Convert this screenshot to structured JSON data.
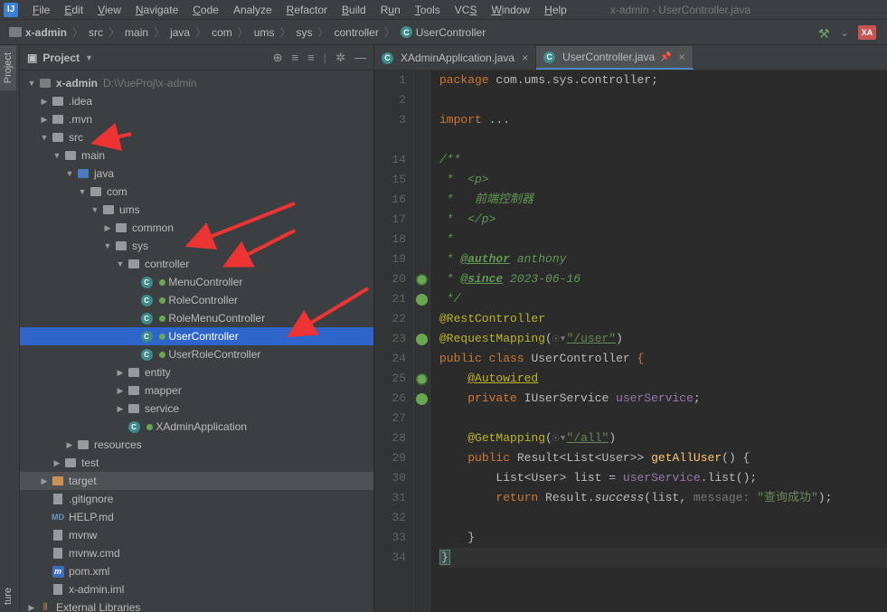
{
  "window_title": "x-admin - UserController.java",
  "menu": {
    "file": "File",
    "edit": "Edit",
    "view": "View",
    "navigate": "Navigate",
    "code": "Code",
    "analyze": "Analyze",
    "refactor": "Refactor",
    "build": "Build",
    "run": "Run",
    "tools": "Tools",
    "vcs": "VCS",
    "window": "Window",
    "help": "Help"
  },
  "breadcrumbs": {
    "root": "x-admin",
    "0": "src",
    "1": "main",
    "2": "java",
    "3": "com",
    "4": "ums",
    "5": "sys",
    "6": "controller",
    "7": "UserController"
  },
  "nav_right_badge": "XA",
  "left_tabs": {
    "project": "Project",
    "structure": "ture"
  },
  "project_panel": {
    "title": "Project",
    "root": "x-admin",
    "root_path": "D:\\VueProj\\x-admin",
    "idea": ".idea",
    "mvn": ".mvn",
    "src": "src",
    "main": "main",
    "java": "java",
    "com": "com",
    "ums": "ums",
    "common": "common",
    "sys": "sys",
    "controller": "controller",
    "menu_ctrl": "MenuController",
    "role_ctrl": "RoleController",
    "rolemenu_ctrl": "RoleMenuController",
    "user_ctrl": "UserController",
    "userrole_ctrl": "UserRoleController",
    "entity": "entity",
    "mapper": "mapper",
    "service": "service",
    "xadmin_app": "XAdminApplication",
    "resources": "resources",
    "test": "test",
    "target": "target",
    "gitignore": ".gitignore",
    "helpmd": "HELP.md",
    "mvnw": "mvnw",
    "mvnwcmd": "mvnw.cmd",
    "pomxml": "pom.xml",
    "iml": "x-admin.iml",
    "ext_lib": "External Libraries"
  },
  "tabs": {
    "t1": "XAdminApplication.java",
    "t2": "UserController.java"
  },
  "code": {
    "gutter": [
      "1",
      "2",
      "3",
      "",
      "14",
      "15",
      "16",
      "17",
      "18",
      "19",
      "20",
      "21",
      "22",
      "23",
      "24",
      "25",
      "26",
      "27",
      "28",
      "29",
      "30",
      "31",
      "32",
      "33",
      "34",
      ""
    ],
    "l1_pkg": "package",
    "l1_txt": "com.ums.sys.controller",
    "l3_imp": "import",
    "l3_txt": "...",
    "c14": "/**",
    "c15": " *  <p>",
    "c16": " *   前端控制器",
    "c17": " *  </p>",
    "c18": " *",
    "c19a": " * ",
    "c19b": "@author",
    "c19c": " anthony",
    "c20a": " * ",
    "c20b": "@since",
    "c20c": " 2023-06-16",
    "c21": " */",
    "a_rest": "@RestController",
    "a_reqmap": "@RequestMapping",
    "a_reqmap_val": "\"/user\"",
    "kw_public": "public",
    "kw_class": "class",
    "cls_user": "UserController",
    "a_autowired": "@Autowired",
    "kw_private": "private",
    "type_svc": "IUserService",
    "fld_svc": "userService",
    "a_getmap": "@GetMapping",
    "a_getmap_val": "\"/all\"",
    "ret_result": "Result",
    "ret_list": "List",
    "ret_user": "User",
    "fn_getall": "getAllUser",
    "var_list": "list",
    "m_list": "list",
    "kw_return": "return",
    "cls_result": "Result",
    "m_success": "success",
    "param_msg": "message:",
    "str_msg": "\"查询成功\""
  }
}
